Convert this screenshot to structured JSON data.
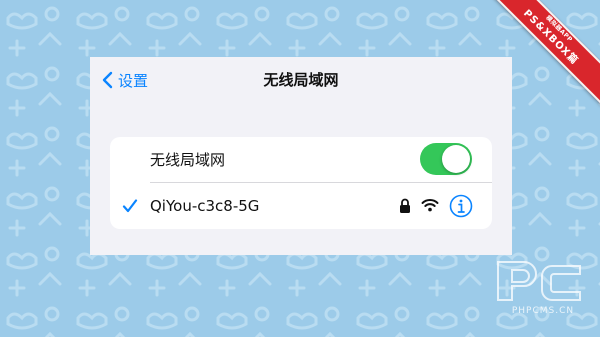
{
  "nav": {
    "back_label": "设置",
    "title": "无线局域网"
  },
  "wifi_toggle": {
    "label": "无线局域网",
    "state": "on"
  },
  "network": {
    "name": "QiYou-c3c8-5G",
    "connected": true,
    "secured": true
  },
  "corner_ribbon": {
    "line1": "模拟器APP",
    "line2": "PS&XBOX篇"
  },
  "watermark": {
    "text": "PHPCMS.CN"
  },
  "colors": {
    "accent": "#0a84ff",
    "toggle_on": "#34c759",
    "background": "#9ccbe9",
    "ribbon": "#d9262c"
  },
  "icons": [
    "chevron-left-icon",
    "checkmark-icon",
    "lock-icon",
    "wifi-icon",
    "info-icon"
  ]
}
